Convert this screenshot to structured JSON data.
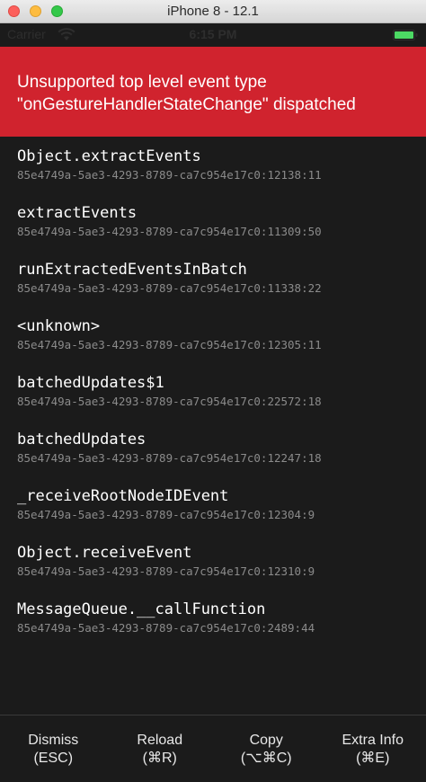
{
  "window": {
    "title": "iPhone 8 - 12.1"
  },
  "status_bar": {
    "carrier": "Carrier",
    "time": "6:15 PM",
    "battery_color": "#4cd964"
  },
  "error": {
    "message": "Unsupported top level event type\n\"onGestureHandlerStateChange\" dispatched",
    "banner_color": "#d0232e"
  },
  "stack": [
    {
      "fn": "Object.extractEvents",
      "loc": "85e4749a-5ae3-4293-8789-ca7c954e17c0:12138:11"
    },
    {
      "fn": "extractEvents",
      "loc": "85e4749a-5ae3-4293-8789-ca7c954e17c0:11309:50"
    },
    {
      "fn": "runExtractedEventsInBatch",
      "loc": "85e4749a-5ae3-4293-8789-ca7c954e17c0:11338:22"
    },
    {
      "fn": "<unknown>",
      "loc": "85e4749a-5ae3-4293-8789-ca7c954e17c0:12305:11"
    },
    {
      "fn": "batchedUpdates$1",
      "loc": "85e4749a-5ae3-4293-8789-ca7c954e17c0:22572:18"
    },
    {
      "fn": "batchedUpdates",
      "loc": "85e4749a-5ae3-4293-8789-ca7c954e17c0:12247:18"
    },
    {
      "fn": "_receiveRootNodeIDEvent",
      "loc": "85e4749a-5ae3-4293-8789-ca7c954e17c0:12304:9"
    },
    {
      "fn": "Object.receiveEvent",
      "loc": "85e4749a-5ae3-4293-8789-ca7c954e17c0:12310:9"
    },
    {
      "fn": "MessageQueue.__callFunction",
      "loc": "85e4749a-5ae3-4293-8789-ca7c954e17c0:2489:44"
    }
  ],
  "toolbar": {
    "dismiss_label": "Dismiss",
    "dismiss_shortcut": "(ESC)",
    "reload_label": "Reload",
    "reload_shortcut": "(⌘R)",
    "copy_label": "Copy",
    "copy_shortcut": "(⌥⌘C)",
    "extra_label": "Extra Info",
    "extra_shortcut": "(⌘E)"
  }
}
